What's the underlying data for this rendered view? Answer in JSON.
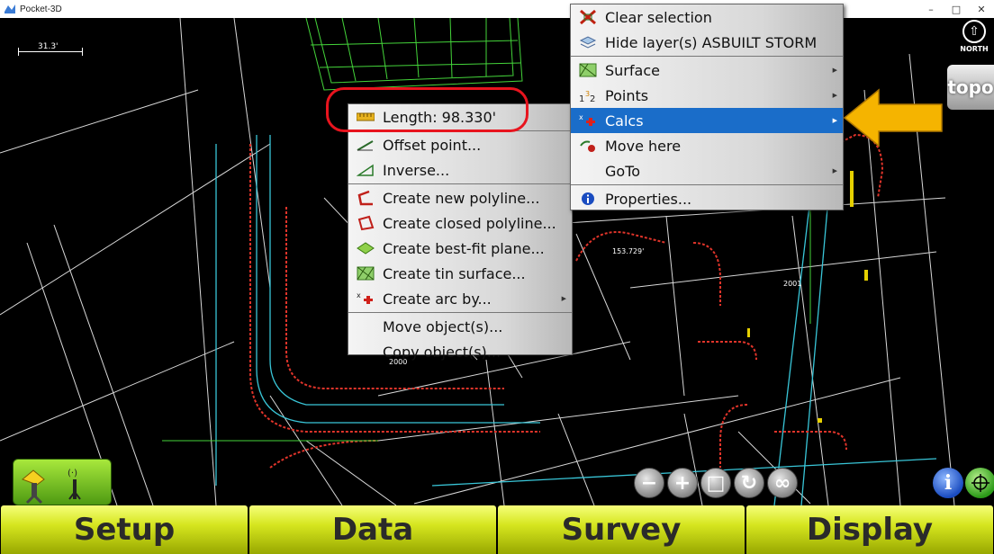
{
  "window": {
    "title": "Pocket-3D",
    "controls": {
      "minimize": "–",
      "maximize": "□",
      "close": "✕"
    }
  },
  "map": {
    "scale_label": "31.3'",
    "north_label": "NORTH",
    "topo_label": "topo",
    "annotations": [
      {
        "text": "153.729'"
      },
      {
        "text": "2001"
      },
      {
        "text": "2000"
      }
    ]
  },
  "context_menu_left": {
    "items": [
      {
        "label": "Length: 98.330'",
        "icon": "ruler-icon"
      },
      {
        "label": "Offset point...",
        "icon": "offset-icon"
      },
      {
        "label": "Inverse...",
        "icon": "inverse-icon"
      },
      {
        "label": "Create new polyline...",
        "icon": "polyline-icon"
      },
      {
        "label": "Create closed polyline...",
        "icon": "closed-polyline-icon"
      },
      {
        "label": "Create best-fit plane...",
        "icon": "plane-icon"
      },
      {
        "label": "Create tin surface...",
        "icon": "tin-surface-icon"
      },
      {
        "label": "Create arc by...",
        "icon": "arc-icon",
        "submenu": true
      },
      {
        "label": "Move object(s)...",
        "icon": ""
      },
      {
        "label": "Copy object(s)...",
        "icon": ""
      }
    ]
  },
  "context_menu_right": {
    "items": [
      {
        "label": "Clear selection",
        "icon": "clear-selection-icon"
      },
      {
        "label": "Hide layer(s) ASBUILT STORM",
        "icon": "hide-layer-icon"
      },
      {
        "label": "Surface",
        "icon": "surface-icon",
        "submenu": true
      },
      {
        "label": "Points",
        "icon": "points-icon",
        "submenu": true
      },
      {
        "label": "Calcs",
        "icon": "calcs-icon",
        "submenu": true,
        "highlighted": true
      },
      {
        "label": "Move here",
        "icon": "move-here-icon"
      },
      {
        "label": "GoTo",
        "icon": "",
        "submenu": true
      },
      {
        "label": "Properties...",
        "icon": "info-icon"
      }
    ]
  },
  "toolbar": {
    "zoom_out": "−",
    "zoom_in": "+",
    "zoom_extents": "□",
    "rotate": "↻",
    "infinity": "∞",
    "info": "i"
  },
  "tabs": [
    "Setup",
    "Data",
    "Survey",
    "Display"
  ],
  "colors": {
    "menu_highlight": "#1a6dc9",
    "tab_yellow": "#d6e61f",
    "highlight_circle": "#e8141e",
    "arrow": "#f5b400"
  }
}
